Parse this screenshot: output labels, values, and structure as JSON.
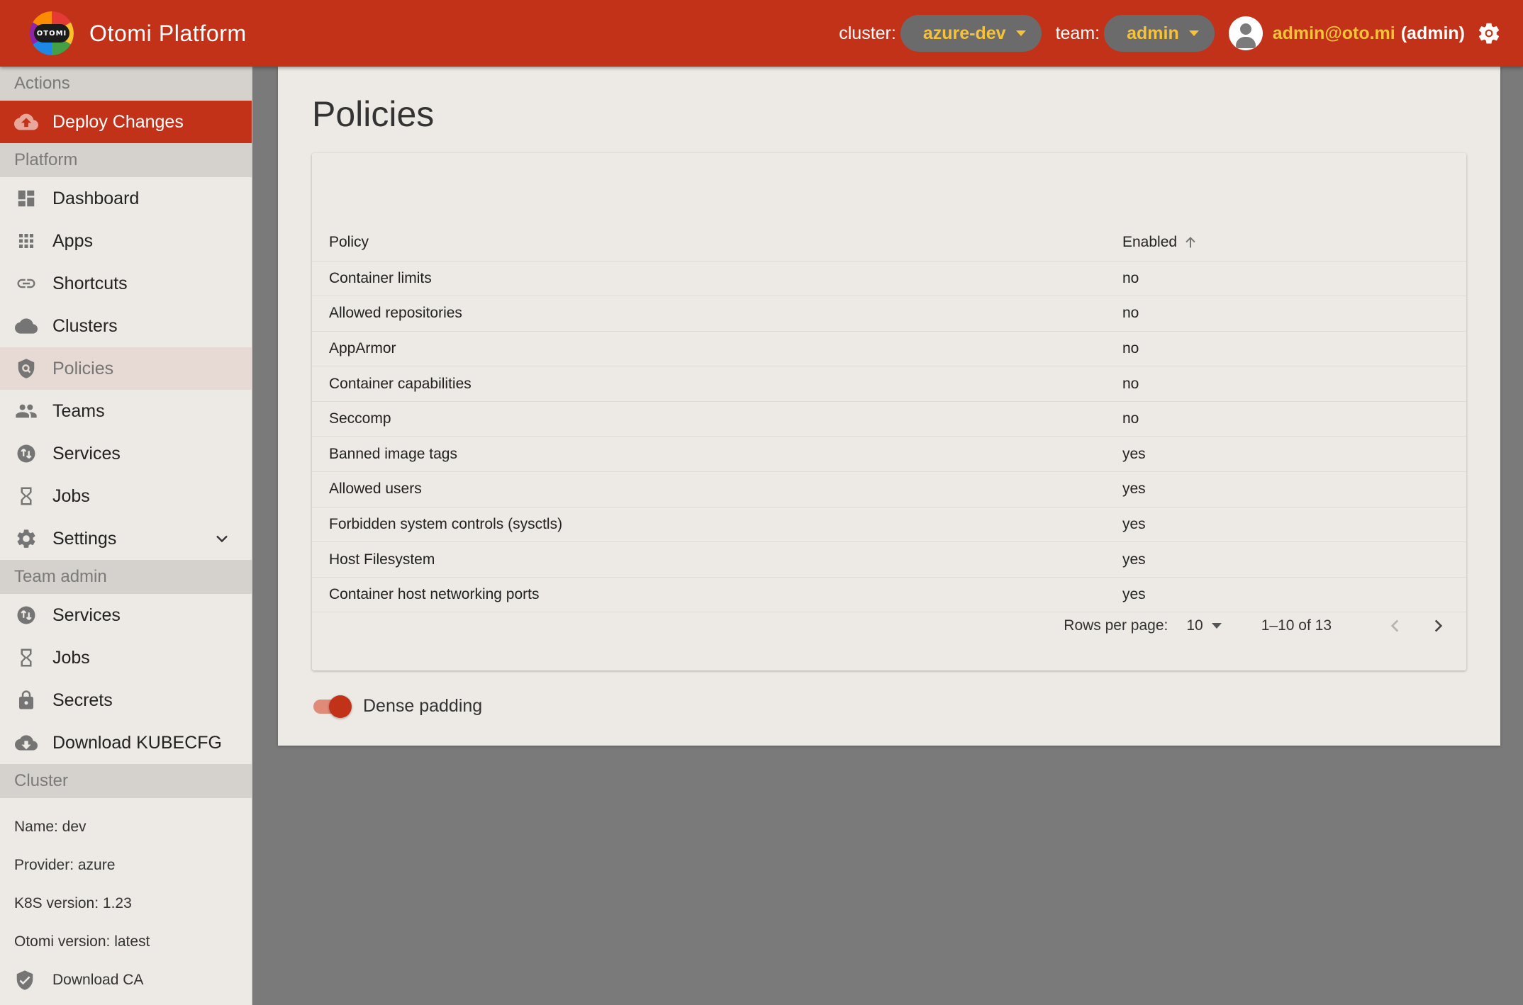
{
  "header": {
    "logo_text": "OTOMI",
    "brand": "Otomi Platform",
    "cluster_label": "cluster:",
    "cluster_value": "azure-dev",
    "team_label": "team:",
    "team_value": "admin",
    "user_email": "admin@oto.mi",
    "user_role": "(admin)",
    "accent_color": "#c23219",
    "highlight_color": "#f5c23a"
  },
  "sidebar": {
    "actions_header": "Actions",
    "deploy_label": "Deploy Changes",
    "platform_header": "Platform",
    "platform_items": [
      {
        "label": "Dashboard",
        "icon": "dashboard-icon"
      },
      {
        "label": "Apps",
        "icon": "apps-grid-icon"
      },
      {
        "label": "Shortcuts",
        "icon": "link-icon"
      },
      {
        "label": "Clusters",
        "icon": "cloud-icon"
      },
      {
        "label": "Policies",
        "icon": "policy-shield-icon"
      },
      {
        "label": "Teams",
        "icon": "people-icon"
      },
      {
        "label": "Services",
        "icon": "services-icon"
      },
      {
        "label": "Jobs",
        "icon": "hourglass-icon"
      },
      {
        "label": "Settings",
        "icon": "gear-icon"
      }
    ],
    "team_admin_header": "Team admin",
    "team_items": [
      {
        "label": "Services",
        "icon": "services-icon"
      },
      {
        "label": "Jobs",
        "icon": "hourglass-icon"
      },
      {
        "label": "Secrets",
        "icon": "lock-icon"
      },
      {
        "label": "Download KUBECFG",
        "icon": "cloud-download-icon"
      }
    ],
    "cluster_header": "Cluster",
    "cluster_info": {
      "name": "Name: dev",
      "provider": "Provider: azure",
      "k8s": "K8S version: 1.23",
      "otomi": "Otomi version: latest"
    },
    "download_ca": "Download CA"
  },
  "main": {
    "title": "Policies",
    "columns": [
      "Policy",
      "Enabled"
    ],
    "rows": [
      {
        "policy": "Container limits",
        "enabled": "no"
      },
      {
        "policy": "Allowed repositories",
        "enabled": "no"
      },
      {
        "policy": "AppArmor",
        "enabled": "no"
      },
      {
        "policy": "Container capabilities",
        "enabled": "no"
      },
      {
        "policy": "Seccomp",
        "enabled": "no"
      },
      {
        "policy": "Banned image tags",
        "enabled": "yes"
      },
      {
        "policy": "Allowed users",
        "enabled": "yes"
      },
      {
        "policy": "Forbidden system controls (sysctls)",
        "enabled": "yes"
      },
      {
        "policy": "Host Filesystem",
        "enabled": "yes"
      },
      {
        "policy": "Container host networking ports",
        "enabled": "yes"
      }
    ],
    "pagination": {
      "rows_per_page_label": "Rows per page:",
      "rows_per_page": "10",
      "range": "1–10 of 13"
    },
    "dense_padding_label": "Dense padding",
    "dense_padding_on": true
  }
}
